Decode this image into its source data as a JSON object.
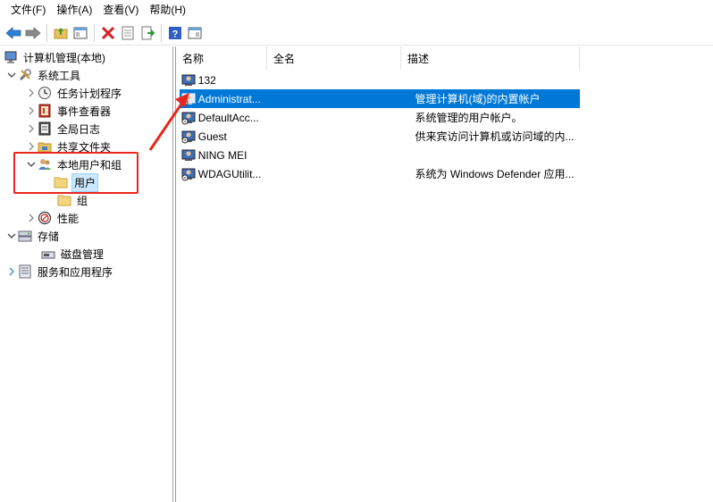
{
  "menu": [
    "文件(F)",
    "操作(A)",
    "查看(V)",
    "帮助(H)"
  ],
  "toolbar": [
    {
      "name": "back-arrow-icon"
    },
    {
      "name": "forward-arrow-icon"
    },
    {
      "name": "up-folder-icon"
    },
    {
      "name": "show-hide-tree-icon"
    },
    {
      "name": "delete-icon"
    },
    {
      "name": "properties-icon"
    },
    {
      "name": "export-list-icon"
    },
    {
      "name": "help-icon"
    },
    {
      "name": "view-pane-icon"
    }
  ],
  "tree": [
    {
      "label": "计算机管理(本地)",
      "icon": "computer-management-icon",
      "expander": ""
    },
    {
      "label": "系统工具",
      "icon": "system-tools-icon",
      "expander": "expanded"
    },
    {
      "label": "任务计划程序",
      "icon": "clock-icon",
      "expander": "collapsed"
    },
    {
      "label": "事件查看器",
      "icon": "event-viewer-icon",
      "expander": "collapsed"
    },
    {
      "label": "全局日志",
      "icon": "log-icon",
      "expander": "collapsed"
    },
    {
      "label": "共享文件夹",
      "icon": "shared-folder-icon",
      "expander": "collapsed"
    },
    {
      "label": "本地用户和组",
      "icon": "users-groups-icon",
      "expander": "expanded"
    },
    {
      "label": "用户",
      "icon": "folder-icon",
      "expander": "",
      "selected": true
    },
    {
      "label": "组",
      "icon": "folder-icon",
      "expander": ""
    },
    {
      "label": "性能",
      "icon": "performance-icon",
      "expander": "collapsed"
    },
    {
      "label": "存储",
      "icon": "storage-icon",
      "expander": "expanded"
    },
    {
      "label": "磁盘管理",
      "icon": "disk-management-icon",
      "expander": ""
    },
    {
      "label": "服务和应用程序",
      "icon": "services-icon",
      "expander": "collapsed-blue"
    }
  ],
  "columns": {
    "name": "名称",
    "fullname": "全名",
    "description": "描述"
  },
  "users": [
    {
      "name": "132",
      "fullname": "",
      "description": ""
    },
    {
      "name": "Administrat...",
      "fullname": "",
      "description": "管理计算机(域)的内置帐户",
      "selected": true
    },
    {
      "name": "DefaultAcc...",
      "fullname": "",
      "description": "系统管理的用户帐户。"
    },
    {
      "name": "Guest",
      "fullname": "",
      "description": "供来宾访问计算机或访问域的内..."
    },
    {
      "name": "NING MEI",
      "fullname": "",
      "description": ""
    },
    {
      "name": "WDAGUtilit...",
      "fullname": "",
      "description": "系统为 Windows Defender 应用..."
    }
  ],
  "colors": {
    "selection": "#0078d7",
    "annotation": "#e8281e"
  }
}
